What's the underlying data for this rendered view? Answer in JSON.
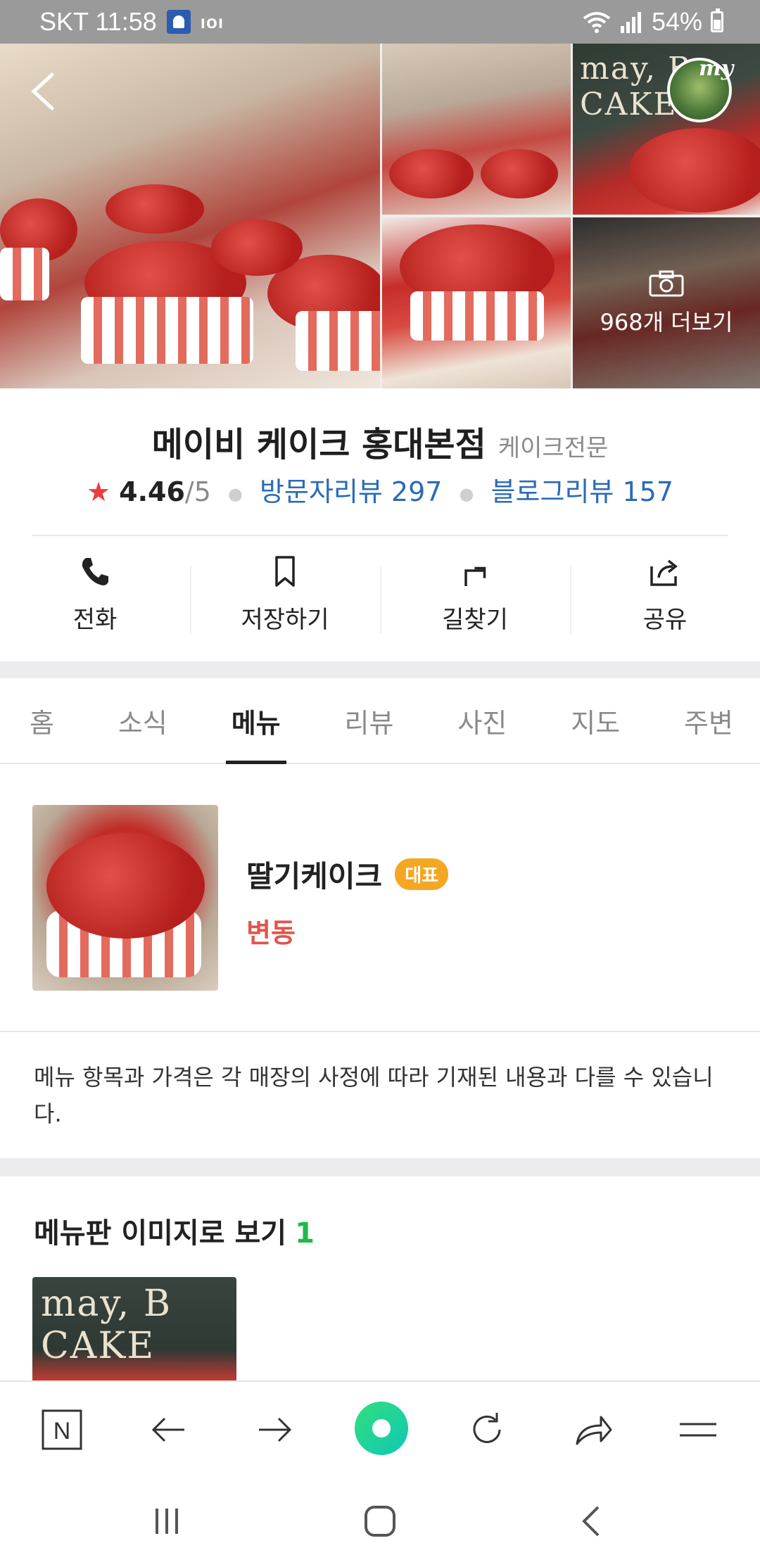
{
  "status_bar": {
    "carrier_time": "SKT 11:58",
    "ioi": "ıoı",
    "battery": "54%"
  },
  "gallery": {
    "more_photos": "968개 더보기",
    "avatar_label": "my",
    "board_text": "may, B CAKE"
  },
  "place": {
    "name": "메이비 케이크 홍대본점",
    "category": "케이크전문",
    "star": "★",
    "rating": "4.46",
    "rating_max": "/5",
    "visitor_reviews": "방문자리뷰 297",
    "blog_reviews": "블로그리뷰 157"
  },
  "actions": [
    {
      "label": "전화",
      "icon": "phone-icon"
    },
    {
      "label": "저장하기",
      "icon": "bookmark-icon"
    },
    {
      "label": "길찾기",
      "icon": "directions-icon"
    },
    {
      "label": "공유",
      "icon": "share-icon"
    }
  ],
  "tabs": [
    {
      "label": "홈",
      "active": false
    },
    {
      "label": "소식",
      "active": false
    },
    {
      "label": "메뉴",
      "active": true
    },
    {
      "label": "리뷰",
      "active": false
    },
    {
      "label": "사진",
      "active": false
    },
    {
      "label": "지도",
      "active": false
    },
    {
      "label": "주변",
      "active": false
    }
  ],
  "menu": {
    "item_name": "딸기케이크",
    "badge": "대표",
    "price": "변동",
    "notice": "메뉴 항목과 가격은 각 매장의 사정에 따라 기재된 내용과 다를 수 있습니다.",
    "board_title": "메뉴판 이미지로 보기",
    "board_count": "1"
  },
  "browser": {
    "n_label": "N"
  },
  "colors": {
    "accent_blue": "#2a6bb8",
    "star_red": "#ee3b3b",
    "price_red": "#e2554e",
    "badge_orange": "#f5a623",
    "count_green": "#1fb94a"
  }
}
